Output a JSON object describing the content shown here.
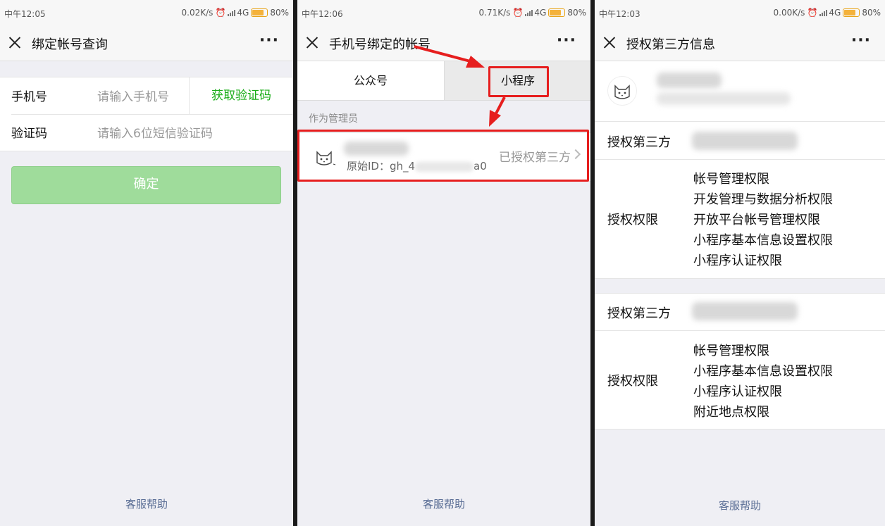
{
  "status_bars": [
    {
      "time": "中午12:05",
      "speed": "0.02K/s",
      "net": "4G",
      "battery": "80%",
      "battery_level": 0.8
    },
    {
      "time": "中午12:06",
      "speed": "0.71K/s",
      "net": "4G",
      "battery": "80%",
      "battery_level": 0.8
    },
    {
      "time": "中午12:03",
      "speed": "0.00K/s",
      "net": "4G",
      "battery": "80%",
      "battery_level": 0.8
    }
  ],
  "panel1": {
    "title": "绑定帐号查询",
    "phone_label": "手机号",
    "phone_placeholder": "请输入手机号",
    "get_code": "获取验证码",
    "code_label": "验证码",
    "code_placeholder": "请输入6位短信验证码",
    "confirm": "确定",
    "footer": "客服帮助"
  },
  "panel2": {
    "title": "手机号绑定的帐号",
    "tab_official": "公众号",
    "tab_miniprogram": "小程序",
    "section": "作为管理员",
    "account_id_prefix": "原始ID：gh_4",
    "account_id_suffix": "a0",
    "account_status": "已授权第三方",
    "footer": "客服帮助"
  },
  "panel3": {
    "title": "授权第三方信息",
    "groups": [
      {
        "third_party_label": "授权第三方",
        "perm_label": "授权权限",
        "perms": [
          "帐号管理权限",
          "开发管理与数据分析权限",
          "开放平台帐号管理权限",
          "小程序基本信息设置权限",
          "小程序认证权限"
        ]
      },
      {
        "third_party_label": "授权第三方",
        "perm_label": "授权权限",
        "perms": [
          "帐号管理权限",
          "小程序基本信息设置权限",
          "小程序认证权限",
          "附近地点权限"
        ]
      }
    ],
    "footer": "客服帮助"
  },
  "colors": {
    "accent_green": "#1aad19",
    "button_disabled": "#9fdc9b",
    "link_blue": "#586c94",
    "annotation_red": "#e61e1e"
  },
  "icons": [
    "close-icon",
    "more-icon",
    "chevron-right-icon",
    "signal-icon",
    "battery-icon",
    "alarm-icon",
    "cat-avatar-icon"
  ]
}
